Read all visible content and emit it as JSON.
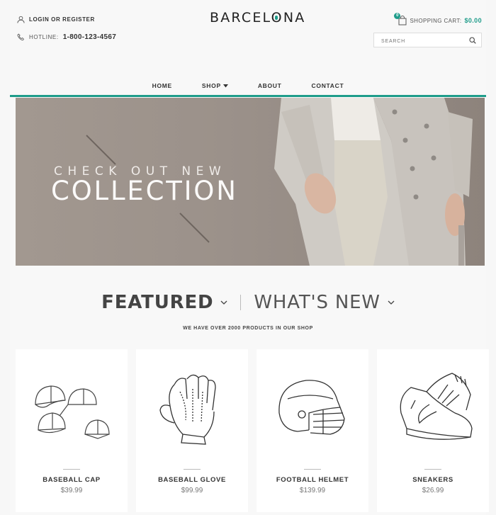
{
  "header": {
    "login_label": "LOGIN OR REGISTER",
    "hotline_label": "HOTLINE:",
    "hotline_number": "1-800-123-4567",
    "logo_pre": "BARCEL",
    "logo_o": "O",
    "logo_post": "NA",
    "cart_label": "SHOPPING CART:",
    "cart_total": "$0.00",
    "cart_count": "0",
    "search_placeholder": "SEARCH"
  },
  "nav": {
    "items": [
      {
        "label": "HOME"
      },
      {
        "label": "SHOP"
      },
      {
        "label": "ABOUT"
      },
      {
        "label": "CONTACT"
      }
    ]
  },
  "hero": {
    "line1": "CHECK OUT NEW",
    "line2": "COLLECTION"
  },
  "tabs": {
    "featured": "FEATURED",
    "whats_new": "WHAT'S NEW"
  },
  "subtitle": "WE HAVE OVER 2000 PRODUCTS IN OUR SHOP",
  "products": [
    {
      "name": "BASEBALL CAP",
      "price": "$39.99",
      "icon": "baseball-cap-icon"
    },
    {
      "name": "BASEBALL GLOVE",
      "price": "$99.99",
      "icon": "baseball-glove-icon"
    },
    {
      "name": "FOOTBALL HELMET",
      "price": "$139.99",
      "icon": "football-helmet-icon"
    },
    {
      "name": "SNEAKERS",
      "price": "$26.99",
      "icon": "sneakers-icon"
    }
  ],
  "colors": {
    "accent": "#1e9c8a",
    "hero_bg": "#9a9089"
  }
}
